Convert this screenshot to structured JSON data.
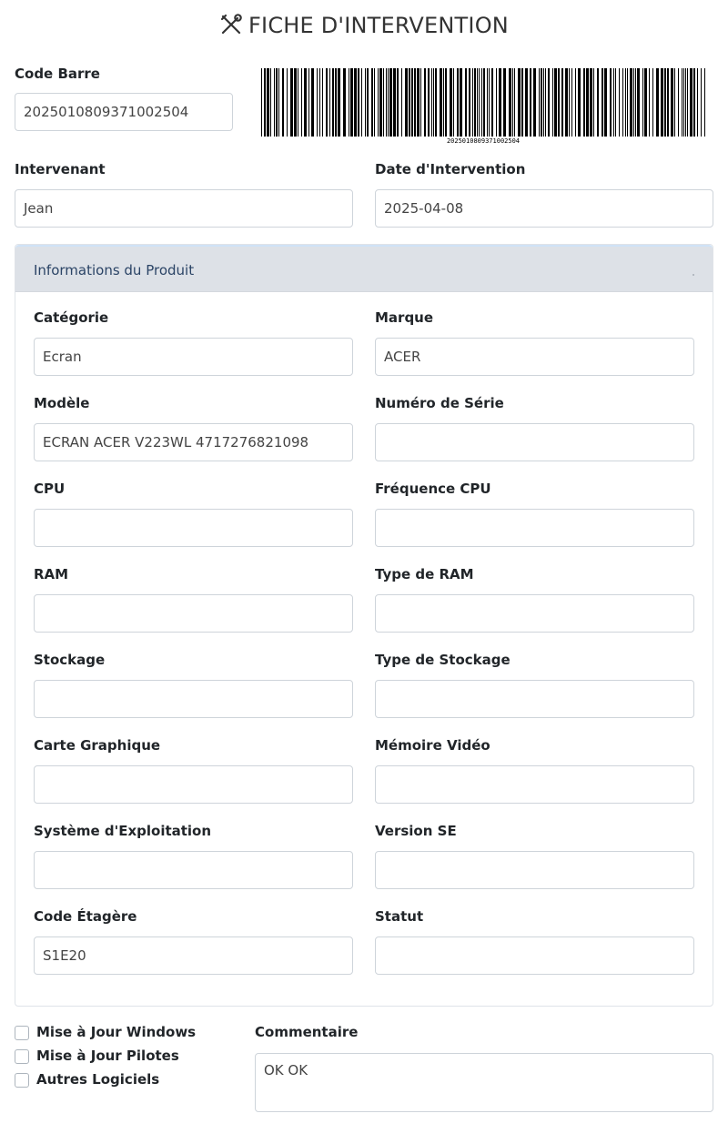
{
  "header": {
    "title": "FICHE D'INTERVENTION",
    "icon": "tools-icon"
  },
  "top": {
    "code_barre_label": "Code Barre",
    "code_barre_value": "2025010809371002504",
    "barcode_caption": "2025010809371002504",
    "intervenant_label": "Intervenant",
    "intervenant_value": "Jean",
    "date_label": "Date d'Intervention",
    "date_value": "2025-04-08"
  },
  "product": {
    "title": "Informations du Produit",
    "categorie_label": "Catégorie",
    "categorie_value": "Ecran",
    "marque_label": "Marque",
    "marque_value": "ACER",
    "modele_label": "Modèle",
    "modele_value": "ECRAN ACER V223WL 4717276821098",
    "serie_label": "Numéro de Série",
    "serie_value": "",
    "cpu_label": "CPU",
    "cpu_value": "",
    "freq_label": "Fréquence CPU",
    "freq_value": "",
    "ram_label": "RAM",
    "ram_value": "",
    "ram_type_label": "Type de RAM",
    "ram_type_value": "",
    "stockage_label": "Stockage",
    "stockage_value": "",
    "stockage_type_label": "Type de Stockage",
    "stockage_type_value": "",
    "gpu_label": "Carte Graphique",
    "gpu_value": "",
    "vram_label": "Mémoire Vidéo",
    "vram_value": "",
    "os_label": "Système d'Exploitation",
    "os_value": "",
    "os_version_label": "Version SE",
    "os_version_value": "",
    "etagere_label": "Code Étagère",
    "etagere_value": "S1E20",
    "statut_label": "Statut",
    "statut_value": ""
  },
  "options": {
    "windows_label": "Mise à Jour Windows",
    "pilotes_label": "Mise à Jour Pilotes",
    "logiciels_label": "Autres Logiciels"
  },
  "comment": {
    "label": "Commentaire",
    "value": "OK OK"
  }
}
